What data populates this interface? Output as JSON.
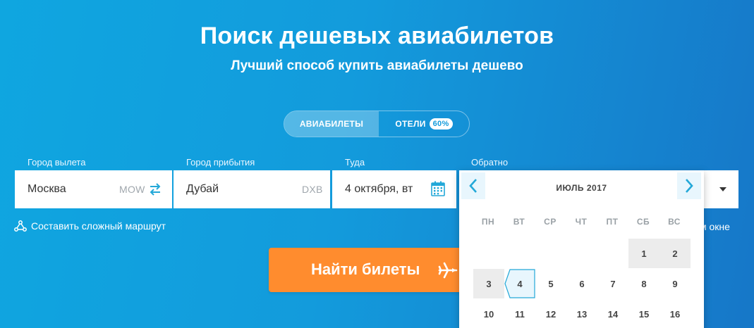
{
  "header": {
    "title": "Поиск дешевых авиабилетов",
    "subtitle": "Лучший способ купить авиабилеты дешево"
  },
  "tabs": {
    "flights": "АВИАБИЛЕТЫ",
    "hotels": "ОТЕЛИ",
    "hotels_badge": "60%"
  },
  "form": {
    "origin_label": "Город вылета",
    "origin_value": "Москва",
    "origin_code": "MOW",
    "destination_label": "Город прибытия",
    "destination_value": "Дубай",
    "destination_code": "DXB",
    "depart_label": "Туда",
    "depart_value": "4 октября, вт",
    "return_label": "Обратно"
  },
  "links": {
    "complex_route": "Составить сложный маршрут",
    "new_window_tail": "м окне"
  },
  "search_button": "Найти билеты",
  "calendar": {
    "month": "ИЮЛЬ",
    "year": "2017",
    "weekdays": [
      "ПН",
      "ВТ",
      "СР",
      "ЧТ",
      "ПТ",
      "СБ",
      "ВС"
    ],
    "days": {
      "d1": "1",
      "d2": "2",
      "d3": "3",
      "d4": "4",
      "d5": "5",
      "d6": "6",
      "d7": "7",
      "d8": "8",
      "d9": "9",
      "d10": "10",
      "d11": "11",
      "d12": "12",
      "d13": "13",
      "d14": "14",
      "d15": "15",
      "d16": "16"
    },
    "selected_day": "4"
  },
  "colors": {
    "accent_blue": "#139bdc",
    "button_orange": "#ff8c2e",
    "icon_teal": "#23a8d8"
  }
}
